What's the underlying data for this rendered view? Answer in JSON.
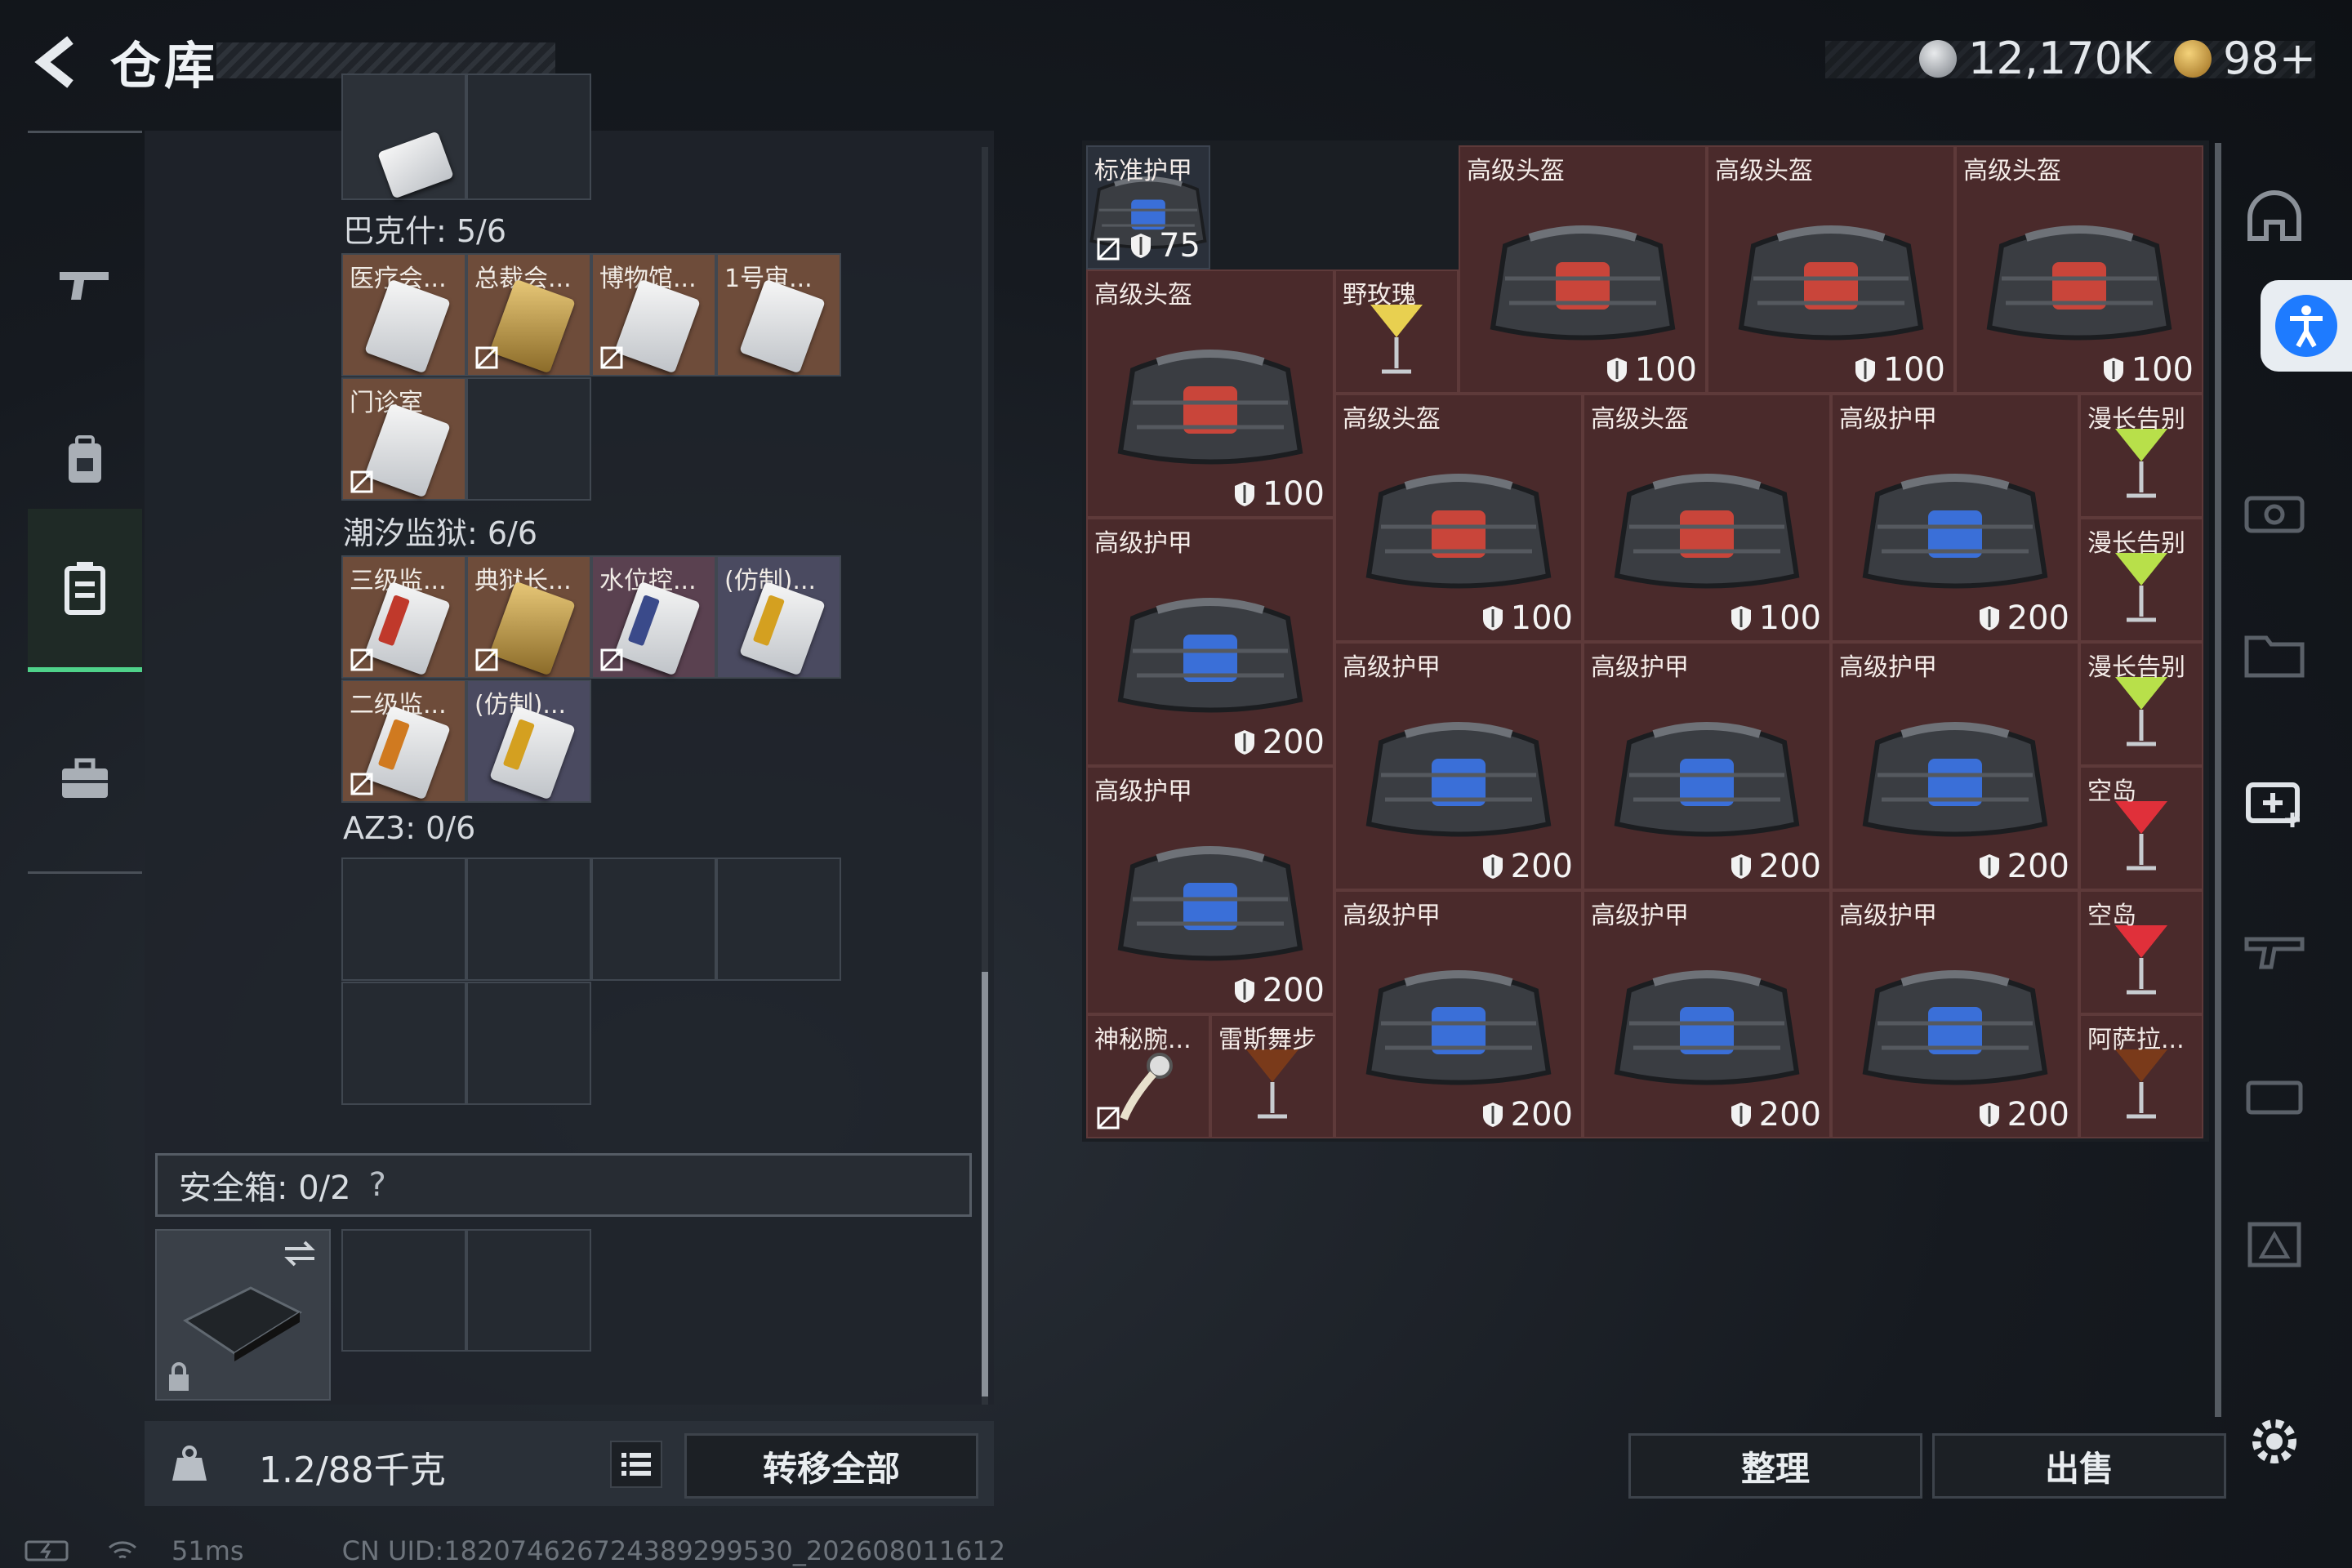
{
  "header": {
    "title": "仓库",
    "currency_a": "12,170K",
    "currency_b": "98+"
  },
  "nav": {
    "items": [
      "weapon",
      "backpack",
      "container",
      "toolbox"
    ],
    "active": "container"
  },
  "left_panel": {
    "sections": [
      {
        "label": "巴克什: 5/6"
      },
      {
        "label": "潮汐监狱: 6/6"
      },
      {
        "label": "AZ3: 0/6"
      }
    ],
    "cards_bakeshi": [
      "医疗会...",
      "总裁会...",
      "博物馆...",
      "1号审...",
      "门诊室"
    ],
    "cards_prison": [
      "三级监...",
      "典狱长...",
      "水位控...",
      "(仿制)...",
      "二级监...",
      "(仿制)..."
    ],
    "safebox_label": "安全箱: 0/2",
    "safebox_help": "?"
  },
  "bottom": {
    "weight": "1.2/88千克",
    "transfer_all": "转移全部",
    "organize": "整理",
    "sell": "出售"
  },
  "grid_items": [
    {
      "label": "标准护甲",
      "value": "75"
    },
    {
      "label": "高级头盔",
      "value": "100"
    },
    {
      "label": "高级头盔",
      "value": "100"
    },
    {
      "label": "高级头盔",
      "value": "100"
    },
    {
      "label": "高级头盔",
      "value": "100"
    },
    {
      "label": "野玫瑰",
      "value": ""
    },
    {
      "label": "高级头盔",
      "value": "100"
    },
    {
      "label": "高级头盔",
      "value": "100"
    },
    {
      "label": "高级护甲",
      "value": "200"
    },
    {
      "label": "漫长告别",
      "value": ""
    },
    {
      "label": "高级护甲",
      "value": "200"
    },
    {
      "label": "漫长告别",
      "value": ""
    },
    {
      "label": "高级护甲",
      "value": "200"
    },
    {
      "label": "高级护甲",
      "value": "200"
    },
    {
      "label": "高级护甲",
      "value": "200"
    },
    {
      "label": "漫长告别",
      "value": ""
    },
    {
      "label": "高级护甲",
      "value": "200"
    },
    {
      "label": "空岛",
      "value": ""
    },
    {
      "label": "高级护甲",
      "value": "200"
    },
    {
      "label": "高级护甲",
      "value": "200"
    },
    {
      "label": "高级护甲",
      "value": "200"
    },
    {
      "label": "空岛",
      "value": ""
    },
    {
      "label": "神秘腕...",
      "value": ""
    },
    {
      "label": "雷斯舞步",
      "value": ""
    },
    {
      "label": "阿萨拉...",
      "value": ""
    }
  ],
  "status": {
    "ping": "51ms",
    "uid": "CN UID:182074626724389299530_202608011612"
  }
}
